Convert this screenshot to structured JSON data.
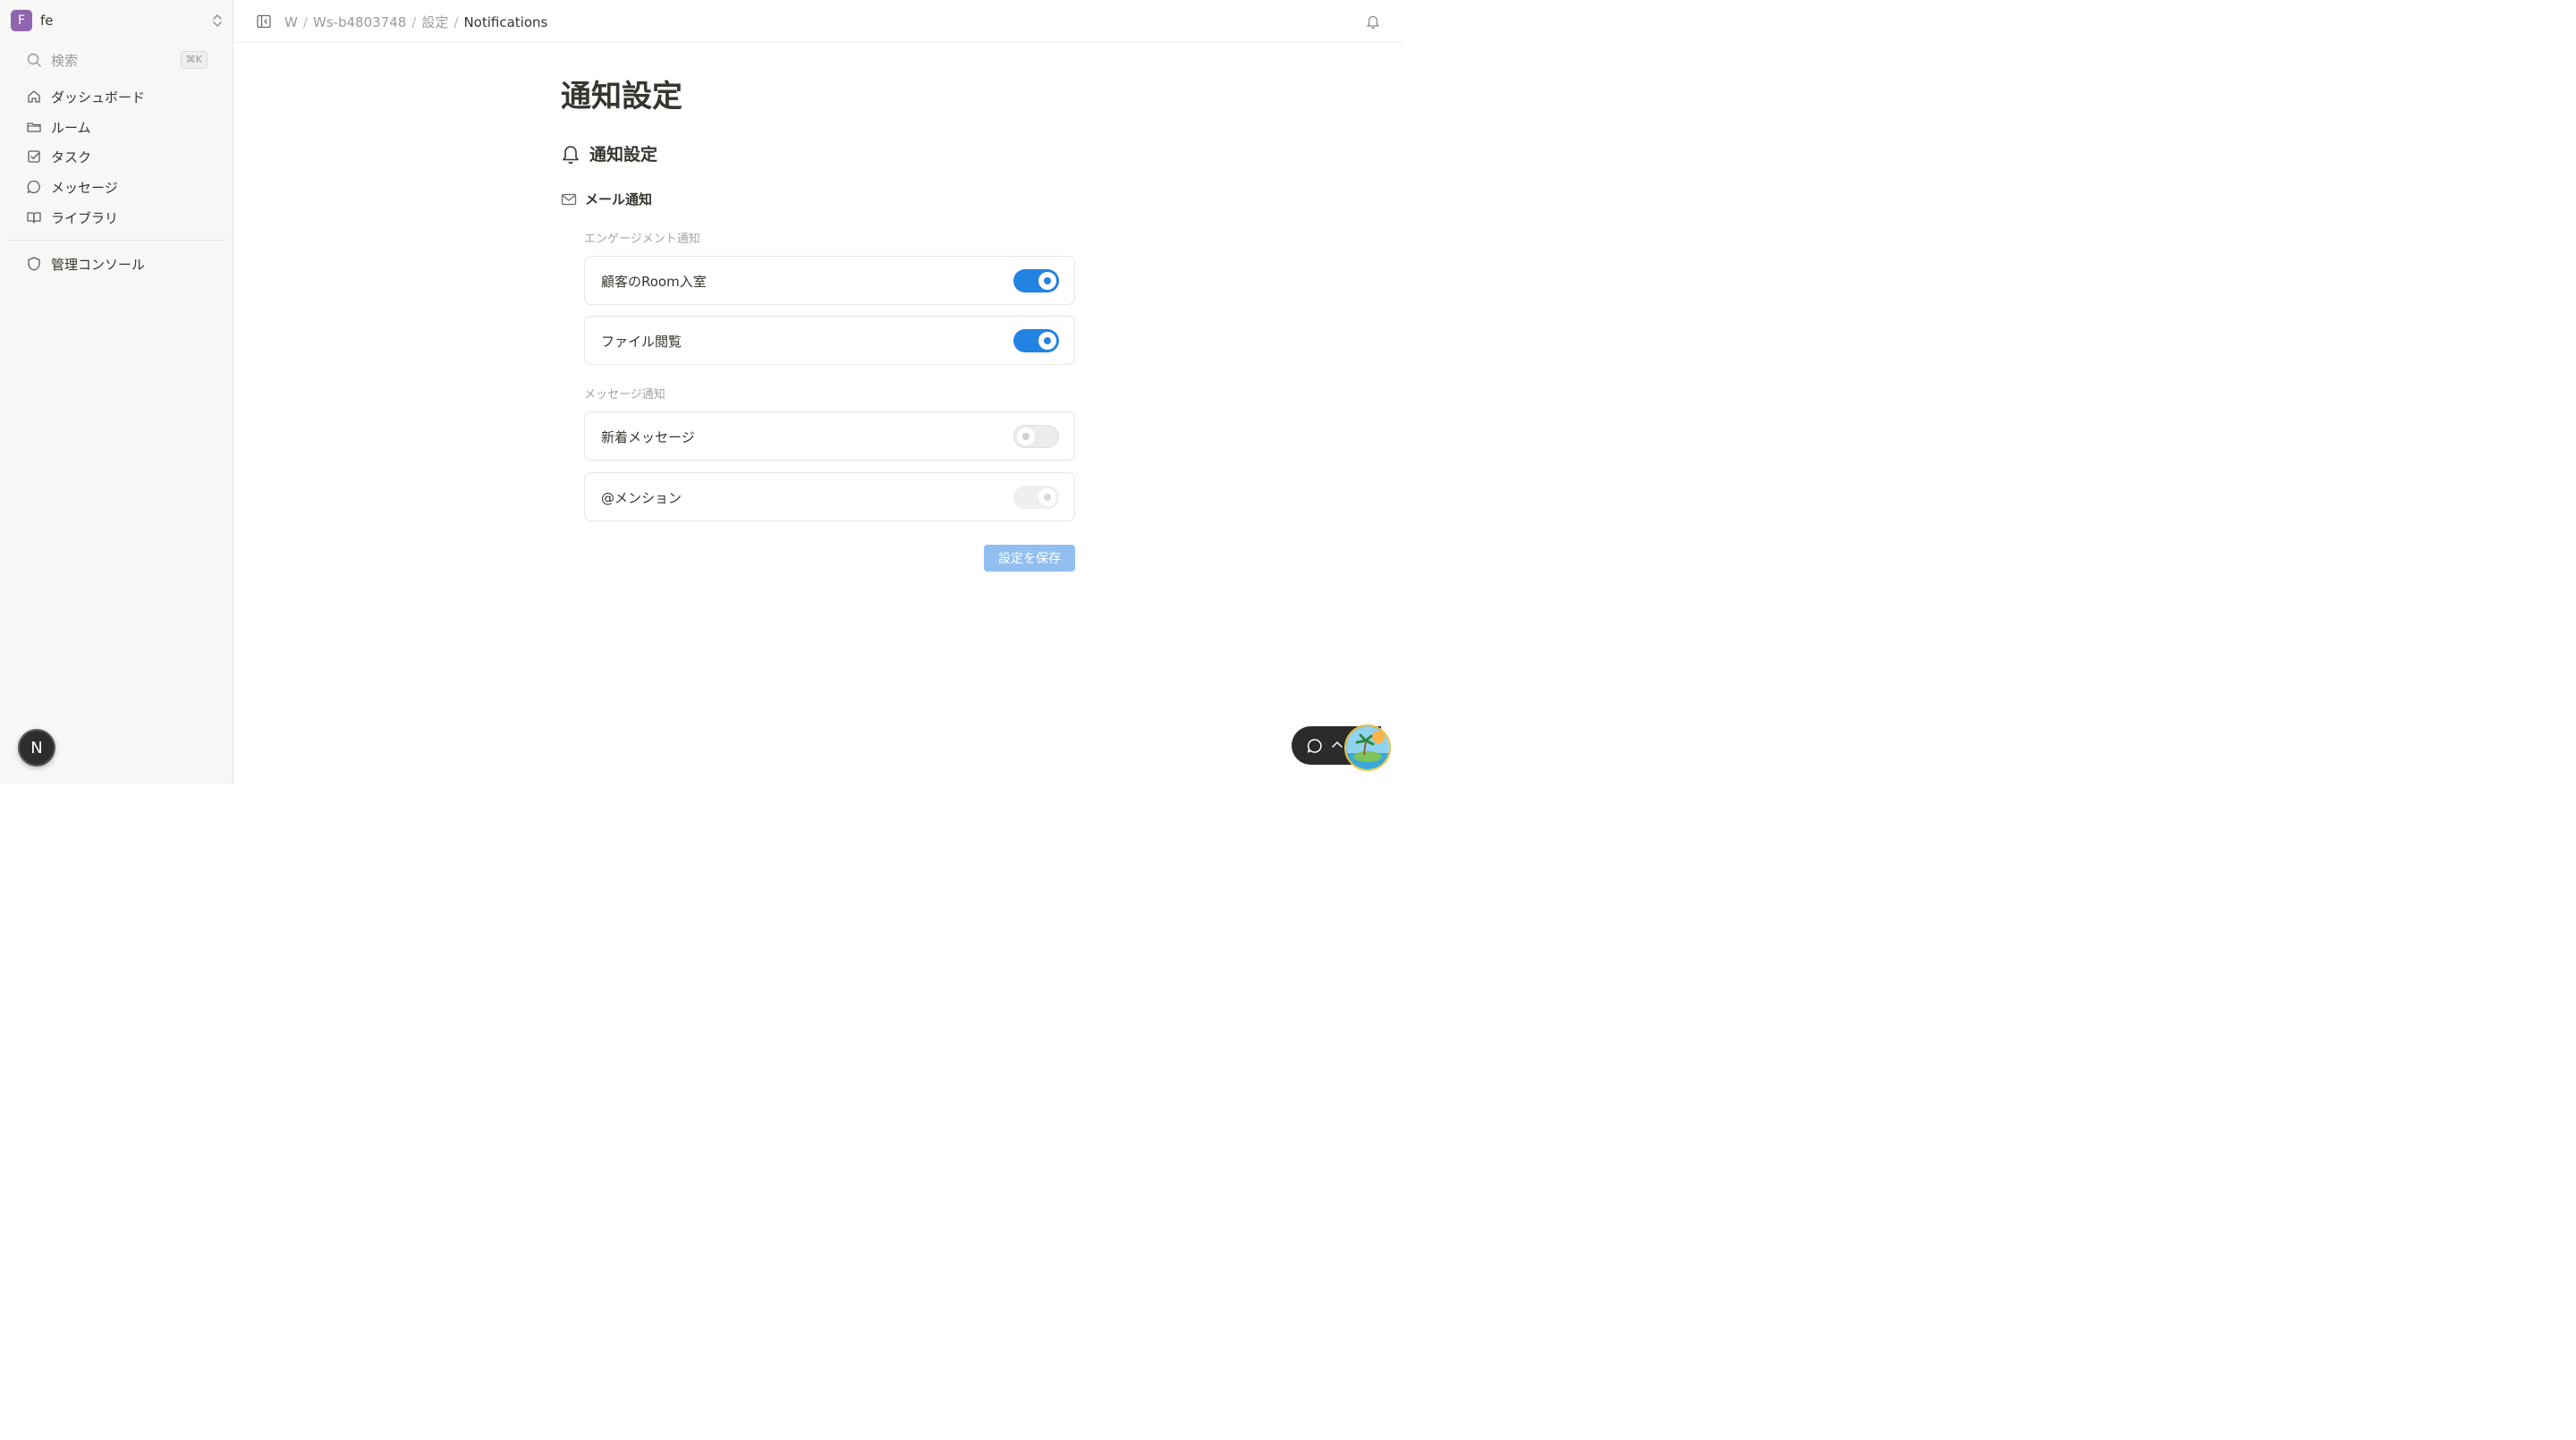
{
  "sidebar": {
    "workspace": {
      "initial": "F",
      "name": "fe",
      "avatar_color": "#9065b0"
    },
    "search": {
      "label": "検索",
      "shortcut": "⌘K"
    },
    "items": [
      {
        "label": "ダッシュボード",
        "icon": "home-icon"
      },
      {
        "label": "ルーム",
        "icon": "folder-icon"
      },
      {
        "label": "タスク",
        "icon": "checkbox-icon"
      },
      {
        "label": "メッセージ",
        "icon": "chat-bubble-icon"
      },
      {
        "label": "ライブラリ",
        "icon": "book-icon"
      }
    ],
    "admin": {
      "label": "管理コンソール",
      "icon": "shield-icon"
    },
    "user_badge": "N"
  },
  "header": {
    "breadcrumb": [
      "W",
      "Ws-b4803748",
      "設定",
      "Notifications"
    ]
  },
  "main": {
    "title": "通知設定",
    "section_title": "通知設定",
    "email_heading": "メール通知",
    "groups": [
      {
        "label": "エンゲージメント通知",
        "settings": [
          {
            "label": "顧客のRoom入室",
            "state": "on"
          },
          {
            "label": "ファイル閲覧",
            "state": "on"
          }
        ]
      },
      {
        "label": "メッセージ通知",
        "settings": [
          {
            "label": "新着メッセージ",
            "state": "off"
          },
          {
            "label": "@メンション",
            "state": "disabled"
          }
        ]
      }
    ],
    "save_label": "設定を保存"
  },
  "colors": {
    "accent": "#2383e2",
    "save_disabled": "#91bff0",
    "sidebar_bg": "#f7f7f5"
  }
}
